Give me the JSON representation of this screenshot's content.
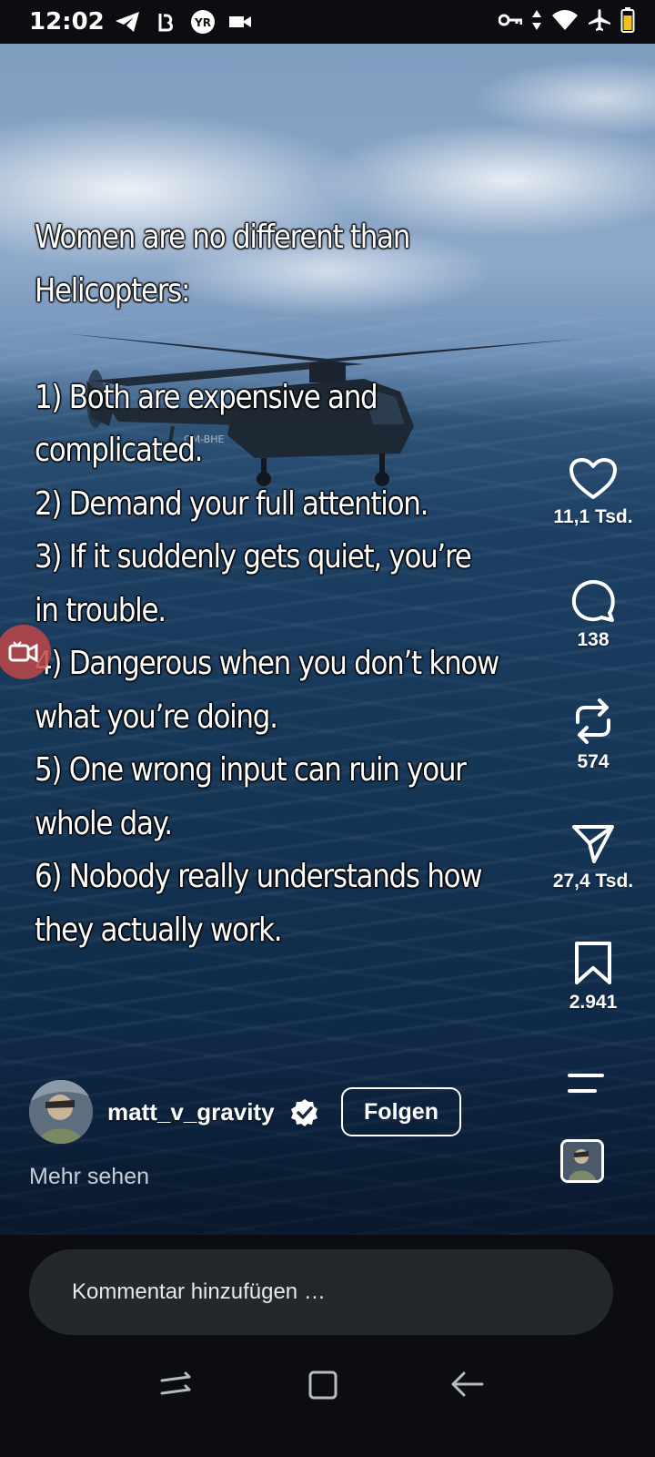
{
  "status_bar": {
    "time": "12:02",
    "left_icons": [
      "telegram-icon",
      "app-b-icon",
      "yr-icon",
      "video-camera-icon"
    ],
    "right_icons": [
      "vpn-key-icon",
      "data-arrows-icon",
      "wifi-icon",
      "airplane-icon",
      "battery-icon"
    ]
  },
  "post": {
    "overlay_text": "Women are no different than\nHelicopters:\n\n1) Both are expensive and\ncomplicated.\n2) Demand your full attention.\n3) If it suddenly gets quiet, you’re\nin trouble.\n4) Dangerous when you don’t know\nwhat you’re doing.\n5) One wrong input can ruin your\nwhole day.\n6) Nobody really understands how\nthey actually work.",
    "helicopter_tail_label": "OM-BHE"
  },
  "actions": {
    "like_count": "11,1 Tsd.",
    "comment_count": "138",
    "repost_count": "574",
    "share_count": "27,4 Tsd.",
    "save_count": "2.941"
  },
  "author": {
    "username": "matt_v_gravity",
    "follow_label": "Folgen",
    "more_label": "Mehr sehen"
  },
  "comment": {
    "placeholder": "Kommentar hinzufügen …"
  },
  "colors": {
    "background": "#0b0d10",
    "comment_bar": "#24272c",
    "floating_button": "#be4646"
  }
}
